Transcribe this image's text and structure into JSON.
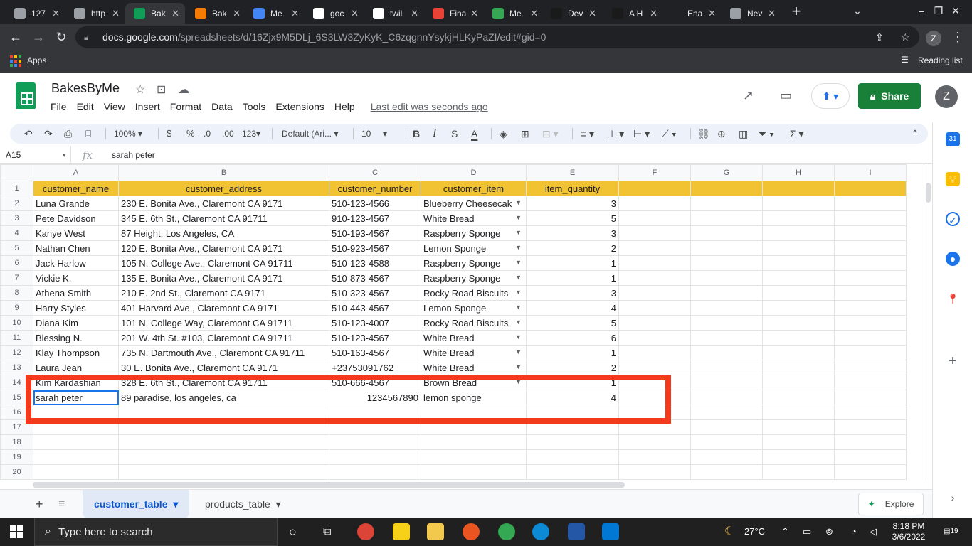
{
  "browser": {
    "tabs": [
      {
        "label": "127",
        "color": "#9aa0a6"
      },
      {
        "label": "http",
        "color": "#9aa0a6"
      },
      {
        "label": "Bak",
        "color": "#0f9d58",
        "active": true
      },
      {
        "label": "Bak",
        "color": "#f57c00"
      },
      {
        "label": "Me",
        "color": "#4285f4"
      },
      {
        "label": "goc",
        "color": "#ffffff"
      },
      {
        "label": "twil",
        "color": "#ffffff"
      },
      {
        "label": "Fina",
        "color": "#ea4335"
      },
      {
        "label": "Me",
        "color": "#34a853"
      },
      {
        "label": "Dev",
        "color": "#1a1a1a"
      },
      {
        "label": "A H",
        "color": "#1a1a1a"
      },
      {
        "label": "Ena",
        "color": "#202124"
      },
      {
        "label": "Nev",
        "color": "#9aa0a6"
      }
    ],
    "url_host": "docs.google.com",
    "url_path": "/spreadsheets/d/16Zjx9M5DLj_6S3LW3ZyKyK_C6zqgnnYsykjHLKyPaZI/edit#gid=0",
    "profile_initial": "Z",
    "bookmarks_apps": "Apps",
    "reading_list": "Reading list"
  },
  "sheets": {
    "title": "BakesByMe",
    "menu": [
      "File",
      "Edit",
      "View",
      "Insert",
      "Format",
      "Data",
      "Tools",
      "Extensions",
      "Help"
    ],
    "last_edit": "Last edit was seconds ago",
    "share_label": "Share",
    "account_initial": "Z",
    "toolbar": {
      "zoom": "100%",
      "currency": "$",
      "percent": "%",
      "dec_less": ".0",
      "dec_more": ".00",
      "more_formats": "123",
      "font": "Default (Ari...",
      "font_size": "10"
    },
    "cell_ref": "A15",
    "formula_value": "sarah peter",
    "columns": [
      "A",
      "B",
      "C",
      "D",
      "E",
      "F",
      "G",
      "H",
      "I"
    ],
    "header_row": [
      "customer_name",
      "customer_address",
      "customer_number",
      "customer_item",
      "item_quantity"
    ],
    "rows": [
      [
        "Luna Grande",
        "230 E. Bonita Ave., Claremont CA 9171",
        "510-123-4566",
        "Blueberry Cheesecak",
        "3"
      ],
      [
        "Pete Davidson",
        "345 E. 6th St., Claremont CA 91711",
        "910-123-4567",
        "White Bread",
        "5"
      ],
      [
        "Kanye West",
        "87 Height, Los Angeles, CA",
        "510-193-4567",
        "Raspberry Sponge",
        "3"
      ],
      [
        "Nathan Chen",
        "120 E. Bonita Ave., Claremont CA 9171",
        "510-923-4567",
        "Lemon Sponge",
        "2"
      ],
      [
        "Jack Harlow",
        "105 N. College Ave., Claremont CA 91711",
        "510-123-4588",
        "Raspberry Sponge",
        "1"
      ],
      [
        "Vickie K.",
        "135 E. Bonita Ave., Claremont CA 9171",
        "510-873-4567",
        "Raspberry Sponge",
        "1"
      ],
      [
        "Athena Smith",
        "210 E. 2nd St., Claremont CA 9171",
        "510-323-4567",
        "Rocky Road Biscuits",
        "3"
      ],
      [
        "Harry Styles",
        "401 Harvard Ave., Claremont CA 9171",
        "510-443-4567",
        "Lemon Sponge",
        "4"
      ],
      [
        "Diana Kim",
        "101 N. College Way, Claremont CA 91711",
        "510-123-4007",
        "Rocky Road Biscuits",
        "5"
      ],
      [
        "Blessing N.",
        "201 W. 4th St. #103, Claremont CA 91711",
        "510-123-4567",
        "White Bread",
        "6"
      ],
      [
        "Klay Thompson",
        "735 N. Dartmouth Ave., Claremont CA 91711",
        "510-163-4567",
        "White Bread",
        "1"
      ],
      [
        "Laura Jean",
        "30 E. Bonita Ave., Claremont CA 9171",
        "+23753091762",
        "White Bread",
        "2"
      ],
      [
        "Kim Kardashian",
        "328 E. 6th St., Claremont CA 91711",
        "510-666-4567",
        "Brown Bread",
        "1"
      ]
    ],
    "new_row": [
      "sarah peter",
      "89 paradise, los angeles, ca",
      "1234567890",
      "lemon sponge",
      "4"
    ],
    "empty_row_numbers": [
      "16",
      "17",
      "18",
      "19",
      "20"
    ],
    "sheet_tabs": [
      "customer_table",
      "products_table"
    ],
    "explore_label": "Explore",
    "header_fill": "#f1c232",
    "highlight_color": "#f33a1d"
  },
  "taskbar": {
    "search_placeholder": "Type here to search",
    "weather": "27°C",
    "time": "8:18 PM",
    "date": "3/6/2022",
    "notif_count": "19"
  }
}
